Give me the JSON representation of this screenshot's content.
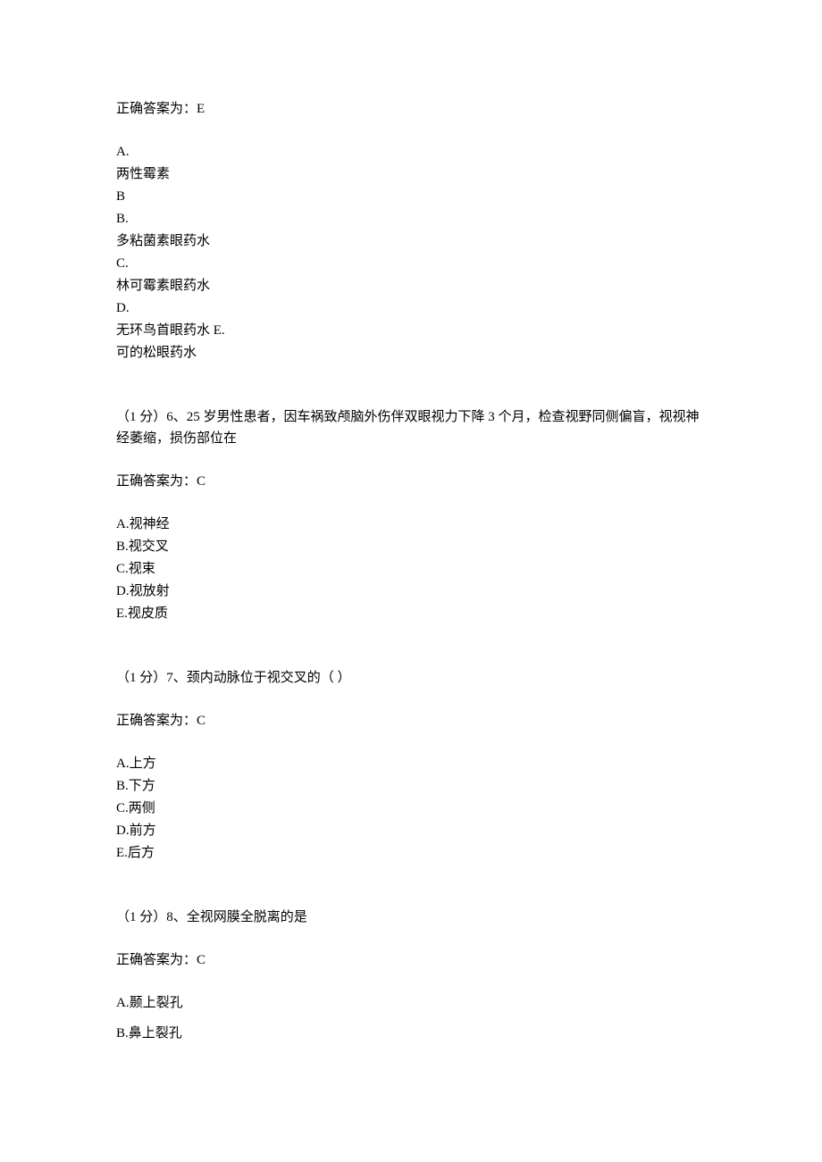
{
  "q5": {
    "answer": "正确答案为：E",
    "options": {
      "a_label": "A.",
      "a_text": "两性霉素",
      "b_label1": "B",
      "b_label2": "B.",
      "b_text": "多粘菌素眼药水",
      "c_label": "C.",
      "c_text": "林可霉素眼药水",
      "d_label": "D.",
      "d_text": "无环鸟首眼药水 E.",
      "e_text": "可的松眼药水"
    }
  },
  "q6": {
    "question": "（1 分）6、25 岁男性患者，因车祸致颅脑外伤伴双眼视力下降 3 个月，检查视野同侧偏盲，视视神经萎缩，损伤部位在",
    "answer": "正确答案为：C",
    "options": {
      "a": "A.视神经",
      "b": "B.视交叉",
      "c": "C.视束",
      "d": "D.视放射",
      "e": "E.视皮质"
    }
  },
  "q7": {
    "question": "（1 分）7、颈内动脉位于视交叉的（   ）",
    "answer": "正确答案为：C",
    "options": {
      "a": "A.上方",
      "b": "B.下方",
      "c": "C.两侧",
      "d": "D.前方",
      "e": "E.后方"
    }
  },
  "q8": {
    "question": "（1 分）8、全视网膜全脱离的是",
    "answer": "正确答案为：C",
    "options": {
      "a": "A.颞上裂孔",
      "b": "B.鼻上裂孔"
    }
  }
}
